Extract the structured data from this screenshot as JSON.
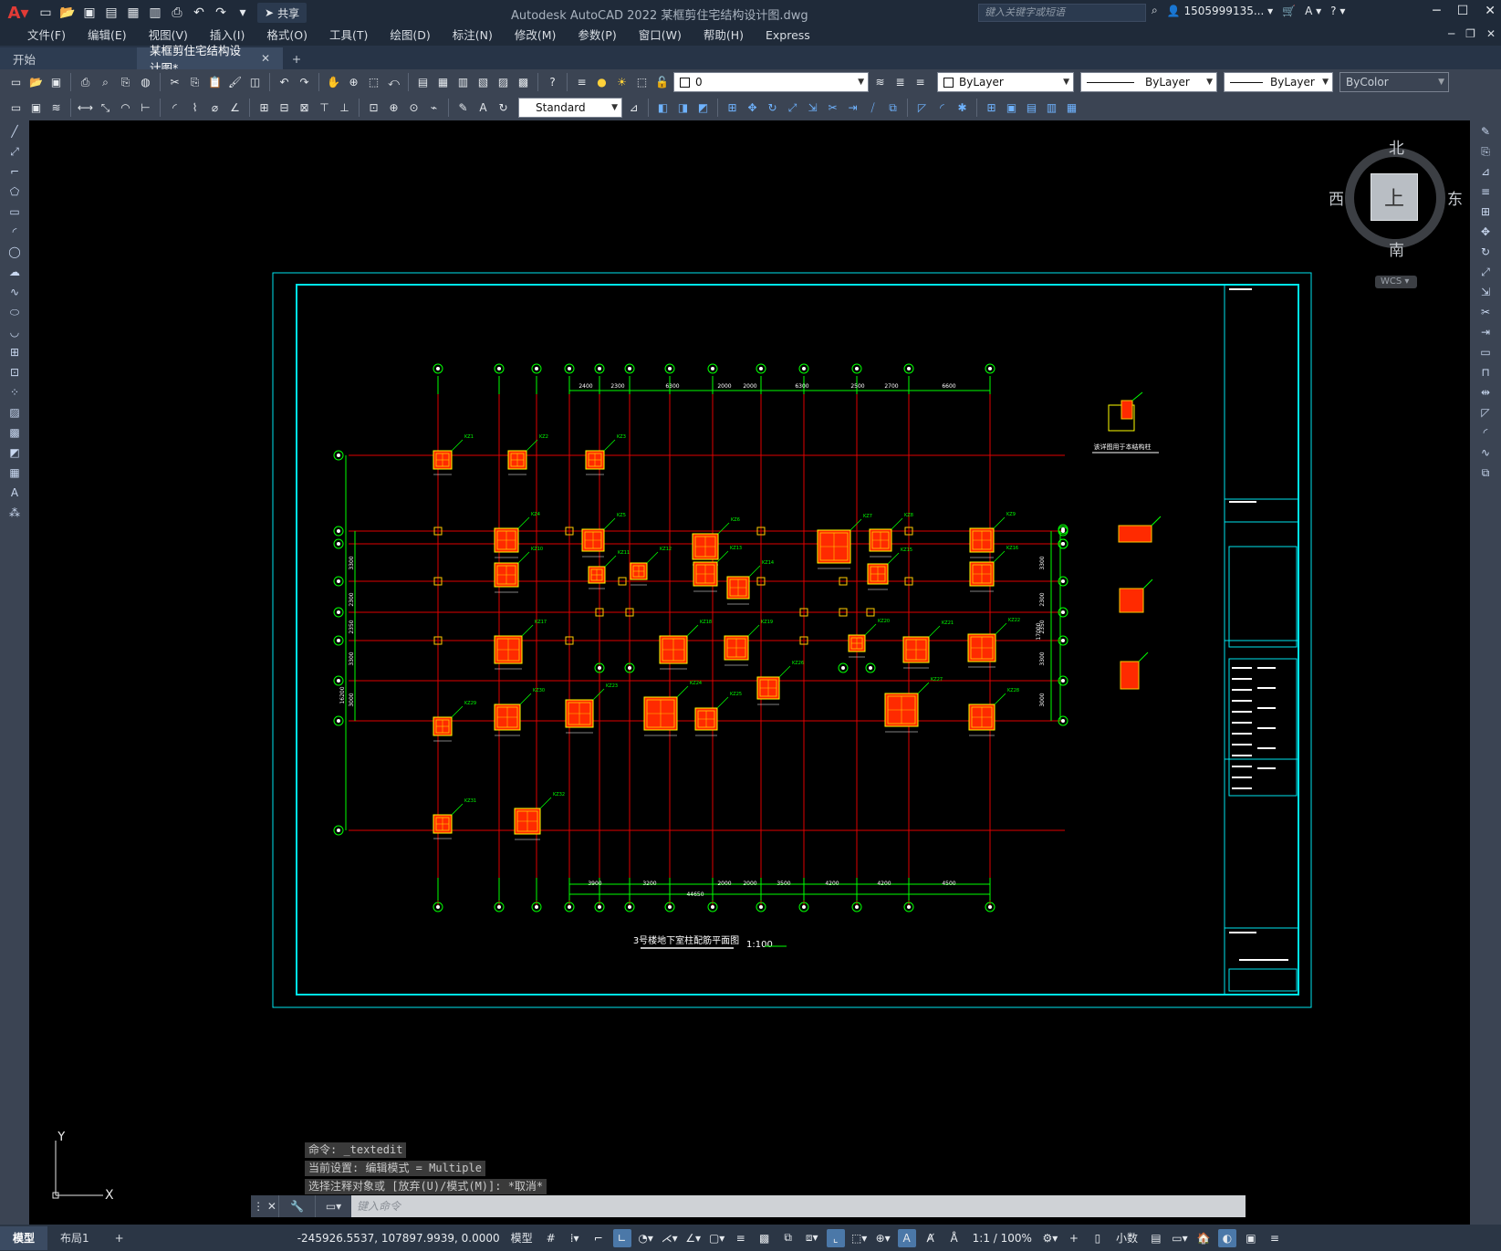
{
  "title_bar": {
    "app_title": "Autodesk AutoCAD 2022    某框剪住宅结构设计图.dwg",
    "share_label": "共享",
    "search_placeholder": "键入关键字或短语",
    "user_name": "1505999135..."
  },
  "menu": [
    "文件(F)",
    "编辑(E)",
    "视图(V)",
    "插入(I)",
    "格式(O)",
    "工具(T)",
    "绘图(D)",
    "标注(N)",
    "修改(M)",
    "参数(P)",
    "窗口(W)",
    "帮助(H)",
    "Express"
  ],
  "tabs": {
    "start": "开始",
    "active": "某框剪住宅结构设计图*",
    "add": "+"
  },
  "toolbar": {
    "layer_value": "0",
    "color_value": "ByLayer",
    "linetype_value": "ByLayer",
    "lineweight_value": "ByLayer",
    "plotstyle_value": "ByColor",
    "textstyle_value": "Standard"
  },
  "viewcube": {
    "north": "北",
    "south": "南",
    "west": "西",
    "east": "东",
    "face": "上",
    "wcs": "WCS"
  },
  "drawing": {
    "plan_title": "3号楼地下室柱配筋平面图",
    "plan_scale": "1:100",
    "detail_title": "该详图用于本结构柱",
    "top_dims": [
      "2400",
      "2300",
      "6300",
      "2000",
      "2000",
      "6300",
      "2500",
      "2700",
      "6600"
    ],
    "bottom_dims": [
      "3900",
      "3200",
      "2000",
      "2000",
      "3500",
      "4200",
      "4200",
      "4500"
    ],
    "bottom_total": "44650",
    "left_dims": [
      "3300",
      "2300",
      "2350",
      "3300",
      "3000"
    ],
    "left_total": "16200",
    "right_dims": [
      "3300",
      "2300",
      "2350",
      "3300",
      "3000"
    ],
    "right_total": "17000",
    "column_tags": [
      "KZ1",
      "KZ2",
      "KZ3",
      "KZ4",
      "KZ5",
      "KZ6",
      "KZ7",
      "KZ8",
      "KZ9",
      "KZ10",
      "KZ11",
      "KZ12",
      "KZ13",
      "KZ14",
      "KZ15",
      "KZ16",
      "KZ17",
      "KZ18",
      "KZ19",
      "KZ20",
      "KZ21",
      "KZ22",
      "KZ23",
      "KZ24",
      "KZ25",
      "KZ26",
      "KZ27",
      "KZ28",
      "KZ29",
      "KZ30",
      "KZ31",
      "KZ32"
    ]
  },
  "command": {
    "history": [
      "命令: _textedit",
      "当前设置: 编辑模式 = Multiple",
      "选择注释对象或 [放弃(U)/模式(M)]: *取消*"
    ],
    "placeholder": "键入命令"
  },
  "ucs": {
    "x": "X",
    "y": "Y"
  },
  "status": {
    "model_tab": "模型",
    "layout_tab": "布局1",
    "add_tab": "+",
    "coordinates": "-245926.5537, 107897.9939, 0.0000",
    "model_space": "模型",
    "scale": "1:1 / 100%",
    "units": "小数"
  },
  "colors": {
    "title_bg": "#1f2a39",
    "toolbar_bg": "#3b4453",
    "canvas_bg": "#000000",
    "frame": "#00e5ee",
    "grid_red": "#e00000",
    "dim_green": "#00ff00",
    "column_fill": "#ff2a00",
    "axis_circle": "#00ff00"
  }
}
